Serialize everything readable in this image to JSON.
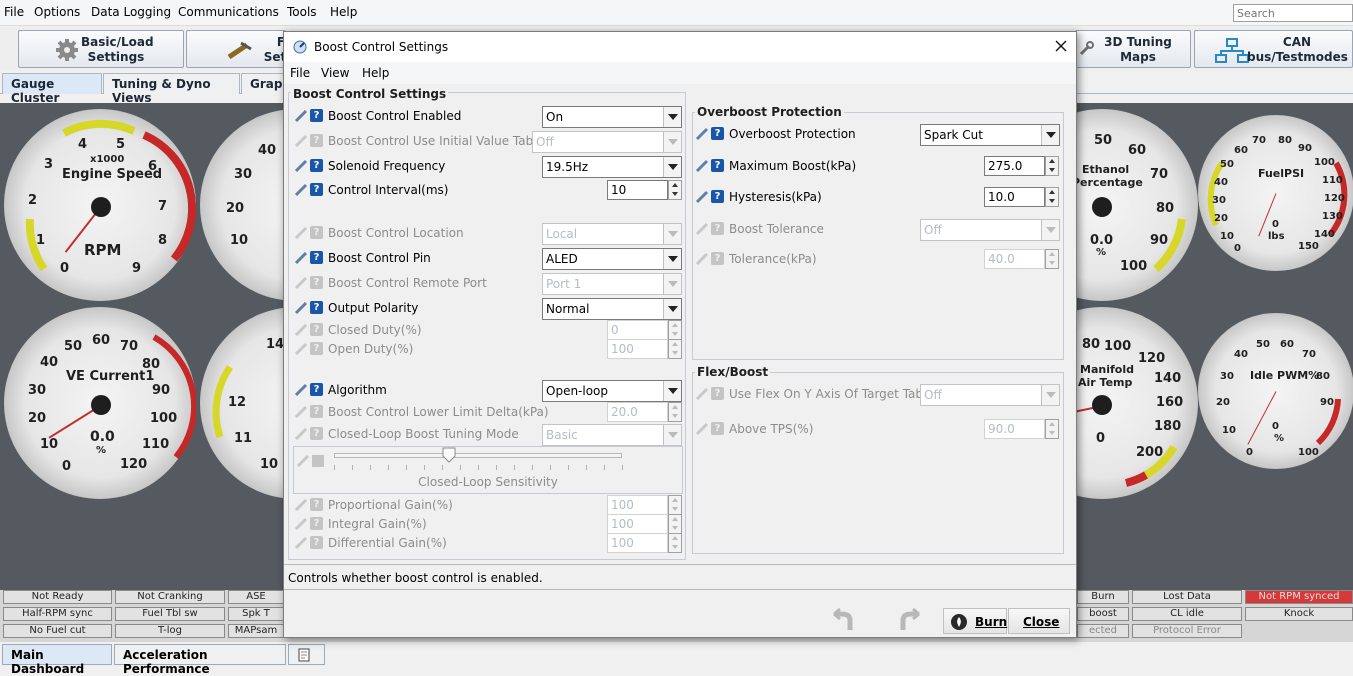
{
  "menu": {
    "file": "File",
    "options": "Options",
    "data_logging": "Data Logging",
    "communications": "Communications",
    "tools": "Tools",
    "help": "Help"
  },
  "search": {
    "placeholder": "Search"
  },
  "toolbar": {
    "basic_load_line1": "Basic/Load",
    "basic_load_line2": "Settings",
    "fuel_line1": "F",
    "fuel_line2": "Set",
    "tuning3d_line1": "3D Tuning",
    "tuning3d_line2": "Maps",
    "can_line1": "CAN",
    "can_line2": "bus/Testmodes"
  },
  "tabs": {
    "gauge_cluster": "Gauge Cluster",
    "tuning_dyno": "Tuning & Dyno Views",
    "graph": "Graph"
  },
  "gauges": {
    "engine_speed": {
      "title": "Engine Speed",
      "unit": "RPM",
      "mult": "x1000",
      "ticks": [
        "0",
        "1",
        "2",
        "3",
        "4",
        "5",
        "6",
        "7",
        "8",
        "9"
      ]
    },
    "g2": {
      "ticks": [
        "10",
        "20",
        "30",
        "40"
      ]
    },
    "ve": {
      "title": "VE Current1",
      "value": "0.0",
      "unit": "%",
      "ticks": [
        "10",
        "20",
        "30",
        "40",
        "50",
        "60",
        "70",
        "80",
        "90",
        "100",
        "110",
        "120",
        "0"
      ]
    },
    "g4": {
      "ticks": [
        "14",
        "12",
        "11",
        "10"
      ]
    },
    "ethanol": {
      "title": "Ethanol",
      "title2": "Percentage",
      "value": "0.0",
      "unit": "%",
      "ticks": [
        "50",
        "60",
        "70",
        "80",
        "90",
        "100"
      ]
    },
    "fuelpsi": {
      "title": "FuelPSI",
      "value": "0",
      "unit": "lbs",
      "ticks": [
        "0",
        "10",
        "20",
        "30",
        "40",
        "50",
        "60",
        "70",
        "80",
        "90",
        "100",
        "110",
        "120",
        "130",
        "140",
        "150"
      ]
    },
    "manifold": {
      "title": "Manifold",
      "title2": "Air Temp",
      "value": "0",
      "ticks": [
        "80",
        "100",
        "120",
        "140",
        "160",
        "180",
        "200"
      ]
    },
    "idle": {
      "title": "Idle PWM%",
      "value": "0",
      "unit": "%",
      "ticks": [
        "0",
        "10",
        "20",
        "30",
        "40",
        "50",
        "60",
        "70",
        "80",
        "90",
        "100"
      ]
    }
  },
  "indicators": [
    "Not Ready",
    "Not Cranking",
    "ASE",
    "Half-RPM sync",
    "Fuel Tbl sw",
    "Spk T",
    "No Fuel cut",
    "T-log",
    "MAPsam",
    "Burn",
    "Lost Data",
    "Not RPM synced",
    "boost",
    "CL idle",
    "Knock",
    "ected",
    "Protocol Error"
  ],
  "bottom_tabs": {
    "main": "Main Dashboard",
    "accel": "Acceleration Performance"
  },
  "dialog": {
    "title": "Boost Control Settings",
    "menu": {
      "file": "File",
      "view": "View",
      "help": "Help"
    },
    "left_legend": "Boost Control Settings",
    "rows": {
      "enabled": {
        "label": "Boost Control Enabled",
        "value": "On"
      },
      "initial": {
        "label": "Boost Control Use Initial Value Table",
        "value": "Off"
      },
      "solenoid": {
        "label": "Solenoid Frequency",
        "value": "19.5Hz"
      },
      "interval": {
        "label": "Control Interval(ms)",
        "value": "10"
      },
      "location": {
        "label": "Boost Control Location",
        "value": "Local"
      },
      "pin": {
        "label": "Boost Control Pin",
        "value": "ALED"
      },
      "remote": {
        "label": "Boost Control Remote Port",
        "value": "Port 1"
      },
      "polarity": {
        "label": "Output Polarity",
        "value": "Normal"
      },
      "closed_duty": {
        "label": "Closed Duty(%)",
        "value": "0"
      },
      "open_duty": {
        "label": "Open Duty(%)",
        "value": "100"
      },
      "algorithm": {
        "label": "Algorithm",
        "value": "Open-loop"
      },
      "lower_limit": {
        "label": "Boost Control Lower Limit Delta(kPa)",
        "value": "20.0"
      },
      "cl_mode": {
        "label": "Closed-Loop Boost Tuning Mode",
        "value": "Basic"
      },
      "sensitivity": {
        "label": "Closed-Loop Sensitivity",
        "level": 0.4
      },
      "p_gain": {
        "label": "Proportional Gain(%)",
        "value": "100"
      },
      "i_gain": {
        "label": "Integral Gain(%)",
        "value": "100"
      },
      "d_gain": {
        "label": "Differential Gain(%)",
        "value": "100"
      }
    },
    "overboost": {
      "legend": "Overboost Protection",
      "protection": {
        "label": "Overboost Protection",
        "value": "Spark Cut"
      },
      "max_boost": {
        "label": "Maximum Boost(kPa)",
        "value": "275.0"
      },
      "hysteresis": {
        "label": "Hysteresis(kPa)",
        "value": "10.0"
      },
      "tolerance": {
        "label": "Boost Tolerance",
        "value": "Off"
      },
      "tolerance_kpa": {
        "label": "Tolerance(kPa)",
        "value": "40.0"
      }
    },
    "flex": {
      "legend": "Flex/Boost",
      "use_flex": {
        "label": "Use Flex On Y Axis Of Target Table",
        "value": "Off"
      },
      "above_tps": {
        "label": "Above TPS(%)",
        "value": "90.0"
      }
    },
    "status": "Controls whether boost control is enabled.",
    "burn": "Burn",
    "close": "Close"
  },
  "colors": {
    "needle": "#c03030",
    "help": "#1857a8",
    "redzone": "#c62828",
    "yellowzone": "#d7d72a"
  }
}
